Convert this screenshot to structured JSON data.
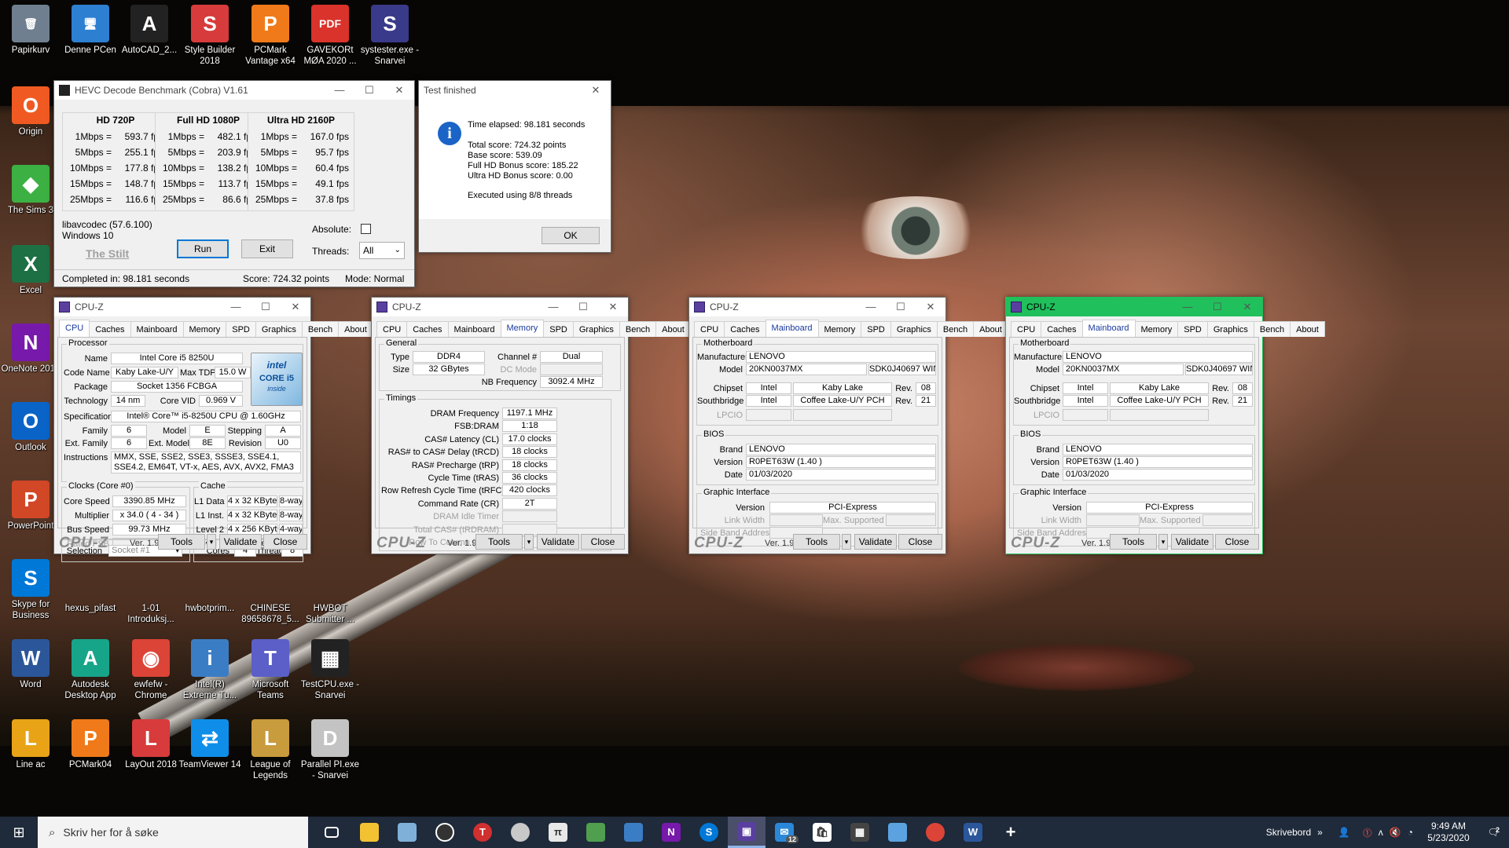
{
  "desktop": {
    "icons": [
      {
        "label": "Papirkurv",
        "glyph": "🗑",
        "color": "#6f7f8f"
      },
      {
        "label": "Denne PCen",
        "glyph": "🖥",
        "color": "#2d7fd1"
      },
      {
        "label": "AutoCAD_2...",
        "glyph": "A",
        "color": "#222222"
      },
      {
        "label": "Style Builder 2018",
        "glyph": "S",
        "color": "#d73b3b"
      },
      {
        "label": "PCMark Vantage x64",
        "glyph": "P",
        "color": "#f07a1a"
      },
      {
        "label": "GAVEKORt MØA 2020 ...",
        "glyph": "PDF",
        "color": "#d9332b"
      },
      {
        "label": "systester.exe - Snarvei",
        "glyph": "S",
        "color": "#3a3a8a"
      },
      {
        "label": "Origin",
        "glyph": "O",
        "color": "#f05a22"
      },
      {
        "label": "The Sims 3",
        "glyph": "◆",
        "color": "#3cb043"
      },
      {
        "label": "Excel",
        "glyph": "X",
        "color": "#1d7044"
      },
      {
        "label": "OneNote 2016",
        "glyph": "N",
        "color": "#7719aa"
      },
      {
        "label": "Outlook",
        "glyph": "O",
        "color": "#0a64c8"
      },
      {
        "label": "PowerPoint",
        "glyph": "P",
        "color": "#d24726"
      },
      {
        "label": "Skype for Business",
        "glyph": "S",
        "color": "#0078d7"
      },
      {
        "label": "hexus_pifast",
        "glyph": "",
        "color": "#000000"
      },
      {
        "label": "1-01 Introduksj...",
        "glyph": "",
        "color": "#000000"
      },
      {
        "label": "hwbotprim...",
        "glyph": "",
        "color": "#000000"
      },
      {
        "label": "CHINESE 89658678_5...",
        "glyph": "",
        "color": "#000000"
      },
      {
        "label": "HWBOT Submitter ...",
        "glyph": "",
        "color": "#000000"
      },
      {
        "label": "Word",
        "glyph": "W",
        "color": "#2b579a"
      },
      {
        "label": "Autodesk Desktop App",
        "glyph": "A",
        "color": "#17a589"
      },
      {
        "label": "ewfefw - Chrome",
        "glyph": "◉",
        "color": "#db4437"
      },
      {
        "label": "Intel(R) Extreme Tu...",
        "glyph": "i",
        "color": "#3b7dc4"
      },
      {
        "label": "Microsoft Teams",
        "glyph": "T",
        "color": "#5b5fc7"
      },
      {
        "label": "TestCPU.exe - Snarvei",
        "glyph": "▦",
        "color": "#222222"
      },
      {
        "label": "Line ac",
        "glyph": "L",
        "color": "#e8a317"
      },
      {
        "label": "PCMark04",
        "glyph": "P",
        "color": "#f07a1a"
      },
      {
        "label": "LayOut 2018",
        "glyph": "L",
        "color": "#d73b3b"
      },
      {
        "label": "TeamViewer 14",
        "glyph": "⇄",
        "color": "#0e8ee9"
      },
      {
        "label": "League of Legends",
        "glyph": "L",
        "color": "#c89b3c"
      },
      {
        "label": "Parallel PI.exe - Snarvei",
        "glyph": "D",
        "color": "#c3c3c3"
      }
    ]
  },
  "hevc": {
    "title": "HEVC Decode Benchmark (Cobra) V1.61",
    "columns": [
      {
        "header": "HD 720P",
        "rows": [
          {
            "label": "1Mbps =",
            "value": "593.7 fps"
          },
          {
            "label": "5Mbps =",
            "value": "255.1 fps"
          },
          {
            "label": "10Mbps =",
            "value": "177.8 fps"
          },
          {
            "label": "15Mbps =",
            "value": "148.7 fps"
          },
          {
            "label": "25Mbps =",
            "value": "116.6 fps"
          }
        ]
      },
      {
        "header": "Full HD 1080P",
        "rows": [
          {
            "label": "1Mbps =",
            "value": "482.1 fps"
          },
          {
            "label": "5Mbps =",
            "value": "203.9 fps"
          },
          {
            "label": "10Mbps =",
            "value": "138.2 fps"
          },
          {
            "label": "15Mbps =",
            "value": "113.7 fps"
          },
          {
            "label": "25Mbps =",
            "value": "86.6 fps"
          }
        ]
      },
      {
        "header": "Ultra HD 2160P",
        "rows": [
          {
            "label": "1Mbps =",
            "value": "167.0 fps"
          },
          {
            "label": "5Mbps =",
            "value": "95.7 fps"
          },
          {
            "label": "10Mbps =",
            "value": "60.4 fps"
          },
          {
            "label": "15Mbps =",
            "value": "49.1 fps"
          },
          {
            "label": "25Mbps =",
            "value": "37.8 fps"
          }
        ]
      }
    ],
    "libavcodec": "libavcodec (57.6.100)",
    "os": "Windows 10",
    "credit": "The Stilt",
    "run": "Run",
    "exit": "Exit",
    "absolute_label": "Absolute:",
    "threads_label": "Threads:",
    "threads_value": "All",
    "status_completed": "Completed in: 98.181 seconds",
    "status_score": "Score: 724.32 points",
    "status_mode": "Mode: Normal"
  },
  "dialog": {
    "title": "Test finished",
    "elapsed": "Time elapsed:  98.181 seconds",
    "total": "Total score:  724.32 points",
    "base": "Base score: 539.09",
    "fullhd": "Full HD Bonus score: 185.22",
    "ultrahd": "Ultra HD Bonus score: 0.00",
    "threads": "Executed using 8/8 threads",
    "ok": "OK"
  },
  "cpuz": {
    "title": "CPU-Z",
    "tabs": [
      "CPU",
      "Caches",
      "Mainboard",
      "Memory",
      "SPD",
      "Graphics",
      "Bench",
      "About"
    ],
    "logo": "CPU-Z",
    "version": "Ver. 1.91.0.x64",
    "tools": "Tools",
    "validate": "Validate",
    "close": "Close",
    "cpu": {
      "processor_group": "Processor",
      "name_label": "Name",
      "name": "Intel Core i5 8250U",
      "codename_label": "Code Name",
      "codename": "Kaby Lake-U/Y",
      "maxtdp_label": "Max TDP",
      "maxtdp": "15.0 W",
      "package_label": "Package",
      "package": "Socket 1356 FCBGA",
      "technology_label": "Technology",
      "technology": "14 nm",
      "corevid_label": "Core VID",
      "corevid": "0.969 V",
      "spec_label": "Specification",
      "spec": "Intel® Core™ i5-8250U CPU @ 1.60GHz",
      "family_label": "Family",
      "family": "6",
      "model_label": "Model",
      "model": "E",
      "stepping_label": "Stepping",
      "stepping": "A",
      "extfamily_label": "Ext. Family",
      "extfamily": "6",
      "extmodel_label": "Ext. Model",
      "extmodel": "8E",
      "revision_label": "Revision",
      "revision": "U0",
      "instructions_label": "Instructions",
      "instructions": "MMX, SSE, SSE2, SSE3, SSSE3, SSE4.1, SSE4.2, EM64T, VT-x, AES, AVX, AVX2, FMA3",
      "logo_intel": "intel",
      "logo_core": "CORE i5",
      "logo_inside": "inside",
      "clocks_group": "Clocks (Core #0)",
      "corespeed_label": "Core Speed",
      "corespeed": "3390.85 MHz",
      "multiplier_label": "Multiplier",
      "multiplier": "x 34.0 ( 4 - 34 )",
      "busspeed_label": "Bus Speed",
      "busspeed": "99.73 MHz",
      "ratedfsb_label": "Rated FSB",
      "cache_group": "Cache",
      "l1d_label": "L1 Data",
      "l1d": "4 x 32 KBytes",
      "l1d_way": "8-way",
      "l1i_label": "L1 Inst.",
      "l1i": "4 x 32 KBytes",
      "l1i_way": "8-way",
      "l2_label": "Level 2",
      "l2": "4 x 256 KBytes",
      "l2_way": "4-way",
      "l3_label": "Level 3",
      "l3": "6 MBytes",
      "l3_way": "12-way",
      "selection_label": "Selection",
      "selection": "Socket #1",
      "cores_label": "Cores",
      "cores": "4",
      "threads_label": "Threads",
      "threads": "8"
    },
    "memory": {
      "general_group": "General",
      "type_label": "Type",
      "type": "DDR4",
      "channel_label": "Channel #",
      "channel": "Dual",
      "size_label": "Size",
      "size": "32 GBytes",
      "dcmode_label": "DC Mode",
      "nbfreq_label": "NB Frequency",
      "nbfreq": "3092.4 MHz",
      "timings_group": "Timings",
      "timings": [
        {
          "label": "DRAM Frequency",
          "value": "1197.1 MHz",
          "dim": false
        },
        {
          "label": "FSB:DRAM",
          "value": "1:18",
          "dim": false
        },
        {
          "label": "CAS# Latency (CL)",
          "value": "17.0 clocks",
          "dim": false
        },
        {
          "label": "RAS# to CAS# Delay (tRCD)",
          "value": "18 clocks",
          "dim": false
        },
        {
          "label": "RAS# Precharge (tRP)",
          "value": "18 clocks",
          "dim": false
        },
        {
          "label": "Cycle Time (tRAS)",
          "value": "36 clocks",
          "dim": false
        },
        {
          "label": "Row Refresh Cycle Time (tRFC)",
          "value": "420 clocks",
          "dim": false
        },
        {
          "label": "Command Rate (CR)",
          "value": "2T",
          "dim": false
        },
        {
          "label": "DRAM Idle Timer",
          "value": "",
          "dim": true
        },
        {
          "label": "Total CAS# (tRDRAM)",
          "value": "",
          "dim": true
        },
        {
          "label": "Row To Column (tRCD)",
          "value": "",
          "dim": true
        }
      ]
    },
    "mainboard": {
      "mb_group": "Motherboard",
      "manufacturer_label": "Manufacturer",
      "manufacturer": "LENOVO",
      "model_label": "Model",
      "model": "20KN0037MX",
      "model_rev": "SDK0J40697 WIN",
      "chipset_label": "Chipset",
      "chipset_vendor": "Intel",
      "chipset_name": "Kaby Lake",
      "chipset_rev_label": "Rev.",
      "chipset_rev": "08",
      "southbridge_label": "Southbridge",
      "sb_vendor": "Intel",
      "sb_name": "Coffee Lake-U/Y PCH",
      "sb_rev_label": "Rev.",
      "sb_rev": "21",
      "lpcio_label": "LPCIO",
      "bios_group": "BIOS",
      "brand_label": "Brand",
      "brand": "LENOVO",
      "version_label": "Version",
      "version": "R0PET63W (1.40 )",
      "date_label": "Date",
      "date": "01/03/2020",
      "gi_group": "Graphic Interface",
      "gi_version_label": "Version",
      "gi_version": "PCI-Express",
      "linkwidth_label": "Link Width",
      "maxsupported_label": "Max. Supported",
      "sideband_label": "Side Band Addressing"
    }
  },
  "taskbar": {
    "search_placeholder": "Skriv her for å søke",
    "desktop_label": "Skrivebord",
    "time": "9:49 AM",
    "date": "5/23/2020",
    "mail_badge": "12",
    "notif_count": "2"
  }
}
